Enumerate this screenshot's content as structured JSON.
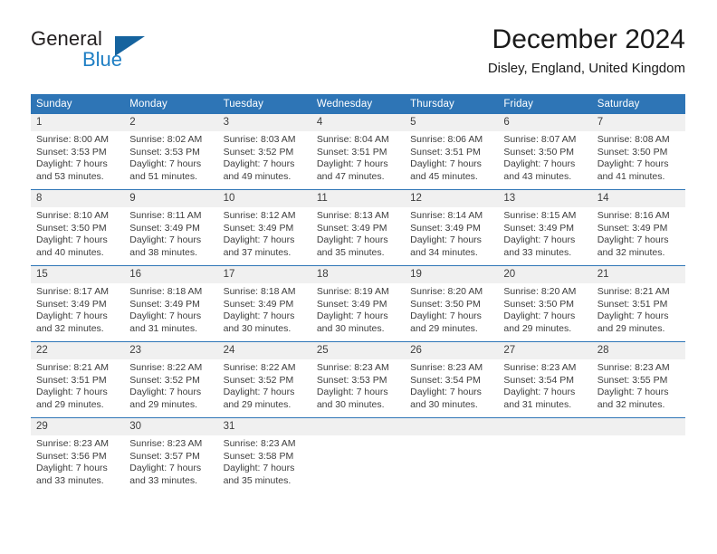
{
  "brand": {
    "word_one": "General",
    "word_two": "Blue",
    "logo_icon": "triangle-logo-icon"
  },
  "header": {
    "title": "December 2024",
    "subtitle": "Disley, England, United Kingdom"
  },
  "colors": {
    "header_blue": "#2e75b6",
    "brand_blue": "#1f7fc4",
    "daynum_band": "#f0f0f0",
    "text": "#3d3d3d"
  },
  "calendar": {
    "weekday_headers": [
      "Sunday",
      "Monday",
      "Tuesday",
      "Wednesday",
      "Thursday",
      "Friday",
      "Saturday"
    ],
    "weeks": [
      [
        {
          "day": "1",
          "sunrise": "Sunrise: 8:00 AM",
          "sunset": "Sunset: 3:53 PM",
          "daylight_line1": "Daylight: 7 hours",
          "daylight_line2": "and 53 minutes."
        },
        {
          "day": "2",
          "sunrise": "Sunrise: 8:02 AM",
          "sunset": "Sunset: 3:53 PM",
          "daylight_line1": "Daylight: 7 hours",
          "daylight_line2": "and 51 minutes."
        },
        {
          "day": "3",
          "sunrise": "Sunrise: 8:03 AM",
          "sunset": "Sunset: 3:52 PM",
          "daylight_line1": "Daylight: 7 hours",
          "daylight_line2": "and 49 minutes."
        },
        {
          "day": "4",
          "sunrise": "Sunrise: 8:04 AM",
          "sunset": "Sunset: 3:51 PM",
          "daylight_line1": "Daylight: 7 hours",
          "daylight_line2": "and 47 minutes."
        },
        {
          "day": "5",
          "sunrise": "Sunrise: 8:06 AM",
          "sunset": "Sunset: 3:51 PM",
          "daylight_line1": "Daylight: 7 hours",
          "daylight_line2": "and 45 minutes."
        },
        {
          "day": "6",
          "sunrise": "Sunrise: 8:07 AM",
          "sunset": "Sunset: 3:50 PM",
          "daylight_line1": "Daylight: 7 hours",
          "daylight_line2": "and 43 minutes."
        },
        {
          "day": "7",
          "sunrise": "Sunrise: 8:08 AM",
          "sunset": "Sunset: 3:50 PM",
          "daylight_line1": "Daylight: 7 hours",
          "daylight_line2": "and 41 minutes."
        }
      ],
      [
        {
          "day": "8",
          "sunrise": "Sunrise: 8:10 AM",
          "sunset": "Sunset: 3:50 PM",
          "daylight_line1": "Daylight: 7 hours",
          "daylight_line2": "and 40 minutes."
        },
        {
          "day": "9",
          "sunrise": "Sunrise: 8:11 AM",
          "sunset": "Sunset: 3:49 PM",
          "daylight_line1": "Daylight: 7 hours",
          "daylight_line2": "and 38 minutes."
        },
        {
          "day": "10",
          "sunrise": "Sunrise: 8:12 AM",
          "sunset": "Sunset: 3:49 PM",
          "daylight_line1": "Daylight: 7 hours",
          "daylight_line2": "and 37 minutes."
        },
        {
          "day": "11",
          "sunrise": "Sunrise: 8:13 AM",
          "sunset": "Sunset: 3:49 PM",
          "daylight_line1": "Daylight: 7 hours",
          "daylight_line2": "and 35 minutes."
        },
        {
          "day": "12",
          "sunrise": "Sunrise: 8:14 AM",
          "sunset": "Sunset: 3:49 PM",
          "daylight_line1": "Daylight: 7 hours",
          "daylight_line2": "and 34 minutes."
        },
        {
          "day": "13",
          "sunrise": "Sunrise: 8:15 AM",
          "sunset": "Sunset: 3:49 PM",
          "daylight_line1": "Daylight: 7 hours",
          "daylight_line2": "and 33 minutes."
        },
        {
          "day": "14",
          "sunrise": "Sunrise: 8:16 AM",
          "sunset": "Sunset: 3:49 PM",
          "daylight_line1": "Daylight: 7 hours",
          "daylight_line2": "and 32 minutes."
        }
      ],
      [
        {
          "day": "15",
          "sunrise": "Sunrise: 8:17 AM",
          "sunset": "Sunset: 3:49 PM",
          "daylight_line1": "Daylight: 7 hours",
          "daylight_line2": "and 32 minutes."
        },
        {
          "day": "16",
          "sunrise": "Sunrise: 8:18 AM",
          "sunset": "Sunset: 3:49 PM",
          "daylight_line1": "Daylight: 7 hours",
          "daylight_line2": "and 31 minutes."
        },
        {
          "day": "17",
          "sunrise": "Sunrise: 8:18 AM",
          "sunset": "Sunset: 3:49 PM",
          "daylight_line1": "Daylight: 7 hours",
          "daylight_line2": "and 30 minutes."
        },
        {
          "day": "18",
          "sunrise": "Sunrise: 8:19 AM",
          "sunset": "Sunset: 3:49 PM",
          "daylight_line1": "Daylight: 7 hours",
          "daylight_line2": "and 30 minutes."
        },
        {
          "day": "19",
          "sunrise": "Sunrise: 8:20 AM",
          "sunset": "Sunset: 3:50 PM",
          "daylight_line1": "Daylight: 7 hours",
          "daylight_line2": "and 29 minutes."
        },
        {
          "day": "20",
          "sunrise": "Sunrise: 8:20 AM",
          "sunset": "Sunset: 3:50 PM",
          "daylight_line1": "Daylight: 7 hours",
          "daylight_line2": "and 29 minutes."
        },
        {
          "day": "21",
          "sunrise": "Sunrise: 8:21 AM",
          "sunset": "Sunset: 3:51 PM",
          "daylight_line1": "Daylight: 7 hours",
          "daylight_line2": "and 29 minutes."
        }
      ],
      [
        {
          "day": "22",
          "sunrise": "Sunrise: 8:21 AM",
          "sunset": "Sunset: 3:51 PM",
          "daylight_line1": "Daylight: 7 hours",
          "daylight_line2": "and 29 minutes."
        },
        {
          "day": "23",
          "sunrise": "Sunrise: 8:22 AM",
          "sunset": "Sunset: 3:52 PM",
          "daylight_line1": "Daylight: 7 hours",
          "daylight_line2": "and 29 minutes."
        },
        {
          "day": "24",
          "sunrise": "Sunrise: 8:22 AM",
          "sunset": "Sunset: 3:52 PM",
          "daylight_line1": "Daylight: 7 hours",
          "daylight_line2": "and 29 minutes."
        },
        {
          "day": "25",
          "sunrise": "Sunrise: 8:23 AM",
          "sunset": "Sunset: 3:53 PM",
          "daylight_line1": "Daylight: 7 hours",
          "daylight_line2": "and 30 minutes."
        },
        {
          "day": "26",
          "sunrise": "Sunrise: 8:23 AM",
          "sunset": "Sunset: 3:54 PM",
          "daylight_line1": "Daylight: 7 hours",
          "daylight_line2": "and 30 minutes."
        },
        {
          "day": "27",
          "sunrise": "Sunrise: 8:23 AM",
          "sunset": "Sunset: 3:54 PM",
          "daylight_line1": "Daylight: 7 hours",
          "daylight_line2": "and 31 minutes."
        },
        {
          "day": "28",
          "sunrise": "Sunrise: 8:23 AM",
          "sunset": "Sunset: 3:55 PM",
          "daylight_line1": "Daylight: 7 hours",
          "daylight_line2": "and 32 minutes."
        }
      ],
      [
        {
          "day": "29",
          "sunrise": "Sunrise: 8:23 AM",
          "sunset": "Sunset: 3:56 PM",
          "daylight_line1": "Daylight: 7 hours",
          "daylight_line2": "and 33 minutes."
        },
        {
          "day": "30",
          "sunrise": "Sunrise: 8:23 AM",
          "sunset": "Sunset: 3:57 PM",
          "daylight_line1": "Daylight: 7 hours",
          "daylight_line2": "and 33 minutes."
        },
        {
          "day": "31",
          "sunrise": "Sunrise: 8:23 AM",
          "sunset": "Sunset: 3:58 PM",
          "daylight_line1": "Daylight: 7 hours",
          "daylight_line2": "and 35 minutes."
        },
        {
          "day": "",
          "sunrise": "",
          "sunset": "",
          "daylight_line1": "",
          "daylight_line2": ""
        },
        {
          "day": "",
          "sunrise": "",
          "sunset": "",
          "daylight_line1": "",
          "daylight_line2": ""
        },
        {
          "day": "",
          "sunrise": "",
          "sunset": "",
          "daylight_line1": "",
          "daylight_line2": ""
        },
        {
          "day": "",
          "sunrise": "",
          "sunset": "",
          "daylight_line1": "",
          "daylight_line2": ""
        }
      ]
    ]
  }
}
